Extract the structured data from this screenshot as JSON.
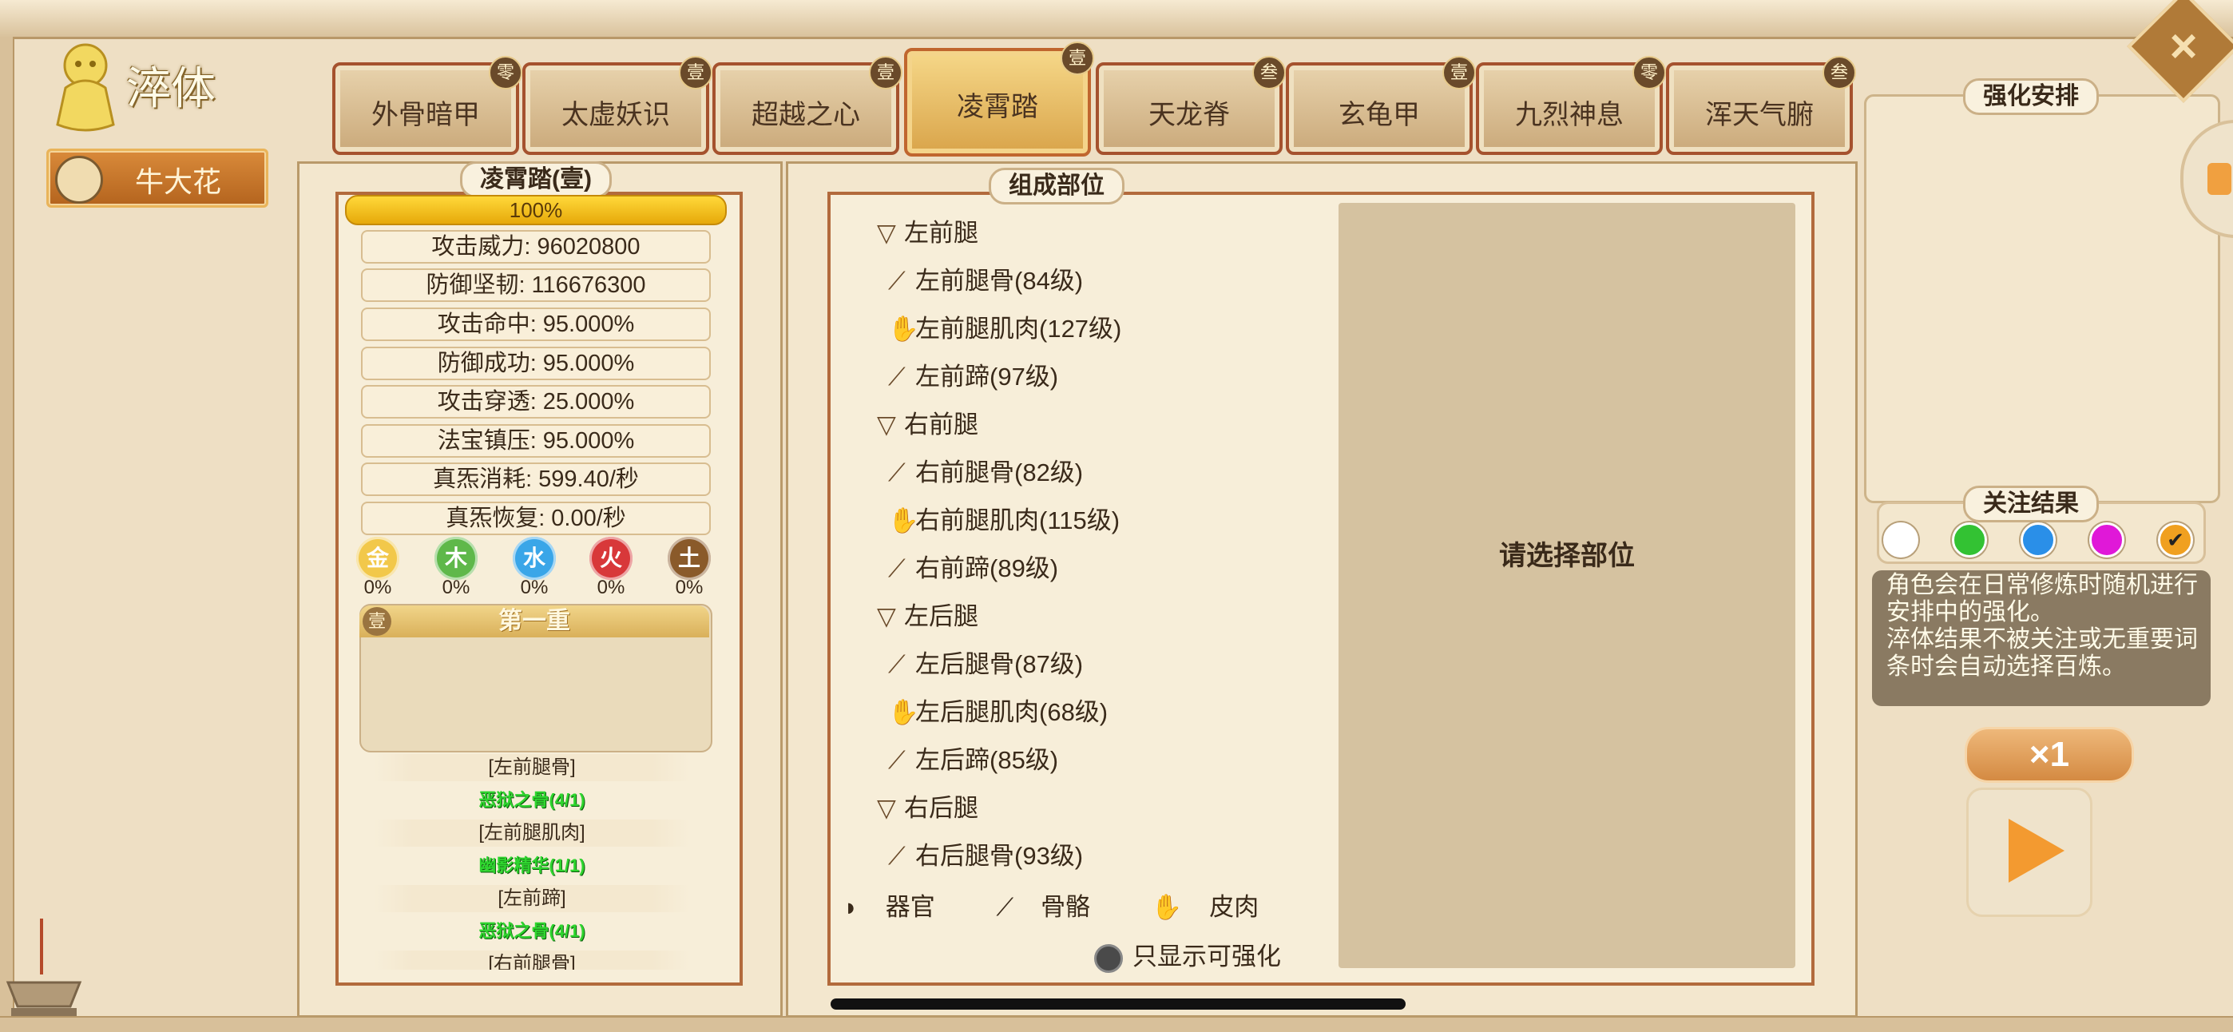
{
  "header": {
    "title": "淬体"
  },
  "character": {
    "name": "牛大花"
  },
  "tabs": [
    {
      "label": "外骨暗甲",
      "badge": "零"
    },
    {
      "label": "太虚妖识",
      "badge": "壹"
    },
    {
      "label": "超越之心",
      "badge": "壹"
    },
    {
      "label": "凌霄踏",
      "badge": "壹",
      "active": true
    },
    {
      "label": "天龙脊",
      "badge": "叁"
    },
    {
      "label": "玄龟甲",
      "badge": "壹"
    },
    {
      "label": "九烈神息",
      "badge": "零"
    },
    {
      "label": "浑天气腑",
      "badge": "叁"
    }
  ],
  "left_panel": {
    "title": "凌霄踏(壹)",
    "progress": "100%",
    "stats": [
      "攻击威力: 96020800",
      "防御坚韧: 116676300",
      "攻击命中: 95.000%",
      "防御成功: 95.000%",
      "攻击穿透: 25.000%",
      "法宝镇压: 95.000%",
      "真炁消耗: 599.40/秒",
      "真炁恢复: 0.00/秒"
    ],
    "elements": [
      {
        "name": "金",
        "pct": "0%",
        "color": "#f2c84a"
      },
      {
        "name": "木",
        "pct": "0%",
        "color": "#5fb84a"
      },
      {
        "name": "水",
        "pct": "0%",
        "color": "#3aa6e8"
      },
      {
        "name": "火",
        "pct": "0%",
        "color": "#d8383a"
      },
      {
        "name": "土",
        "pct": "0%",
        "color": "#8a5a2a"
      }
    ],
    "layer": {
      "badge": "壹",
      "title": "第一重"
    },
    "parts": [
      {
        "name": "[左前腿骨]",
        "effect": "恶狱之骨(4/1)"
      },
      {
        "name": "[左前腿肌肉]",
        "effect": "幽影精华(1/1)"
      },
      {
        "name": "[左前蹄]",
        "effect": "恶狱之骨(4/1)"
      },
      {
        "name": "[右前腿骨]",
        "effect": ""
      }
    ]
  },
  "mid_panel": {
    "title": "组成部位",
    "placeholder": "请选择部位",
    "tree": [
      {
        "type": "group",
        "label": "左前腿"
      },
      {
        "type": "bone",
        "label": "左前腿骨(84级)"
      },
      {
        "type": "flesh",
        "label": "左前腿肌肉(127级)"
      },
      {
        "type": "bone",
        "label": "左前蹄(97级)"
      },
      {
        "type": "group",
        "label": "右前腿"
      },
      {
        "type": "bone",
        "label": "右前腿骨(82级)"
      },
      {
        "type": "flesh",
        "label": "右前腿肌肉(115级)"
      },
      {
        "type": "bone",
        "label": "右前蹄(89级)"
      },
      {
        "type": "group",
        "label": "左后腿"
      },
      {
        "type": "bone",
        "label": "左后腿骨(87级)"
      },
      {
        "type": "flesh",
        "label": "左后腿肌肉(68级)"
      },
      {
        "type": "bone",
        "label": "左后蹄(85级)"
      },
      {
        "type": "group",
        "label": "右后腿"
      },
      {
        "type": "bone",
        "label": "右后腿骨(93级)"
      }
    ],
    "legend": {
      "organ": "器官",
      "bone": "骨骼",
      "flesh": "皮肉"
    },
    "only_strengthenable": "只显示可强化"
  },
  "right_panel": {
    "plan_title": "强化安排",
    "focus_title": "关注结果",
    "focus_colors": [
      "#ffffff",
      "#33c233",
      "#2a8fe8",
      "#e018d8",
      "#f0a020"
    ],
    "description": "角色会在日常修炼时随机进行安排中的强化。\n淬体结果不被关注或无重要词条时会自动选择百炼。",
    "multiplier": "×1"
  }
}
